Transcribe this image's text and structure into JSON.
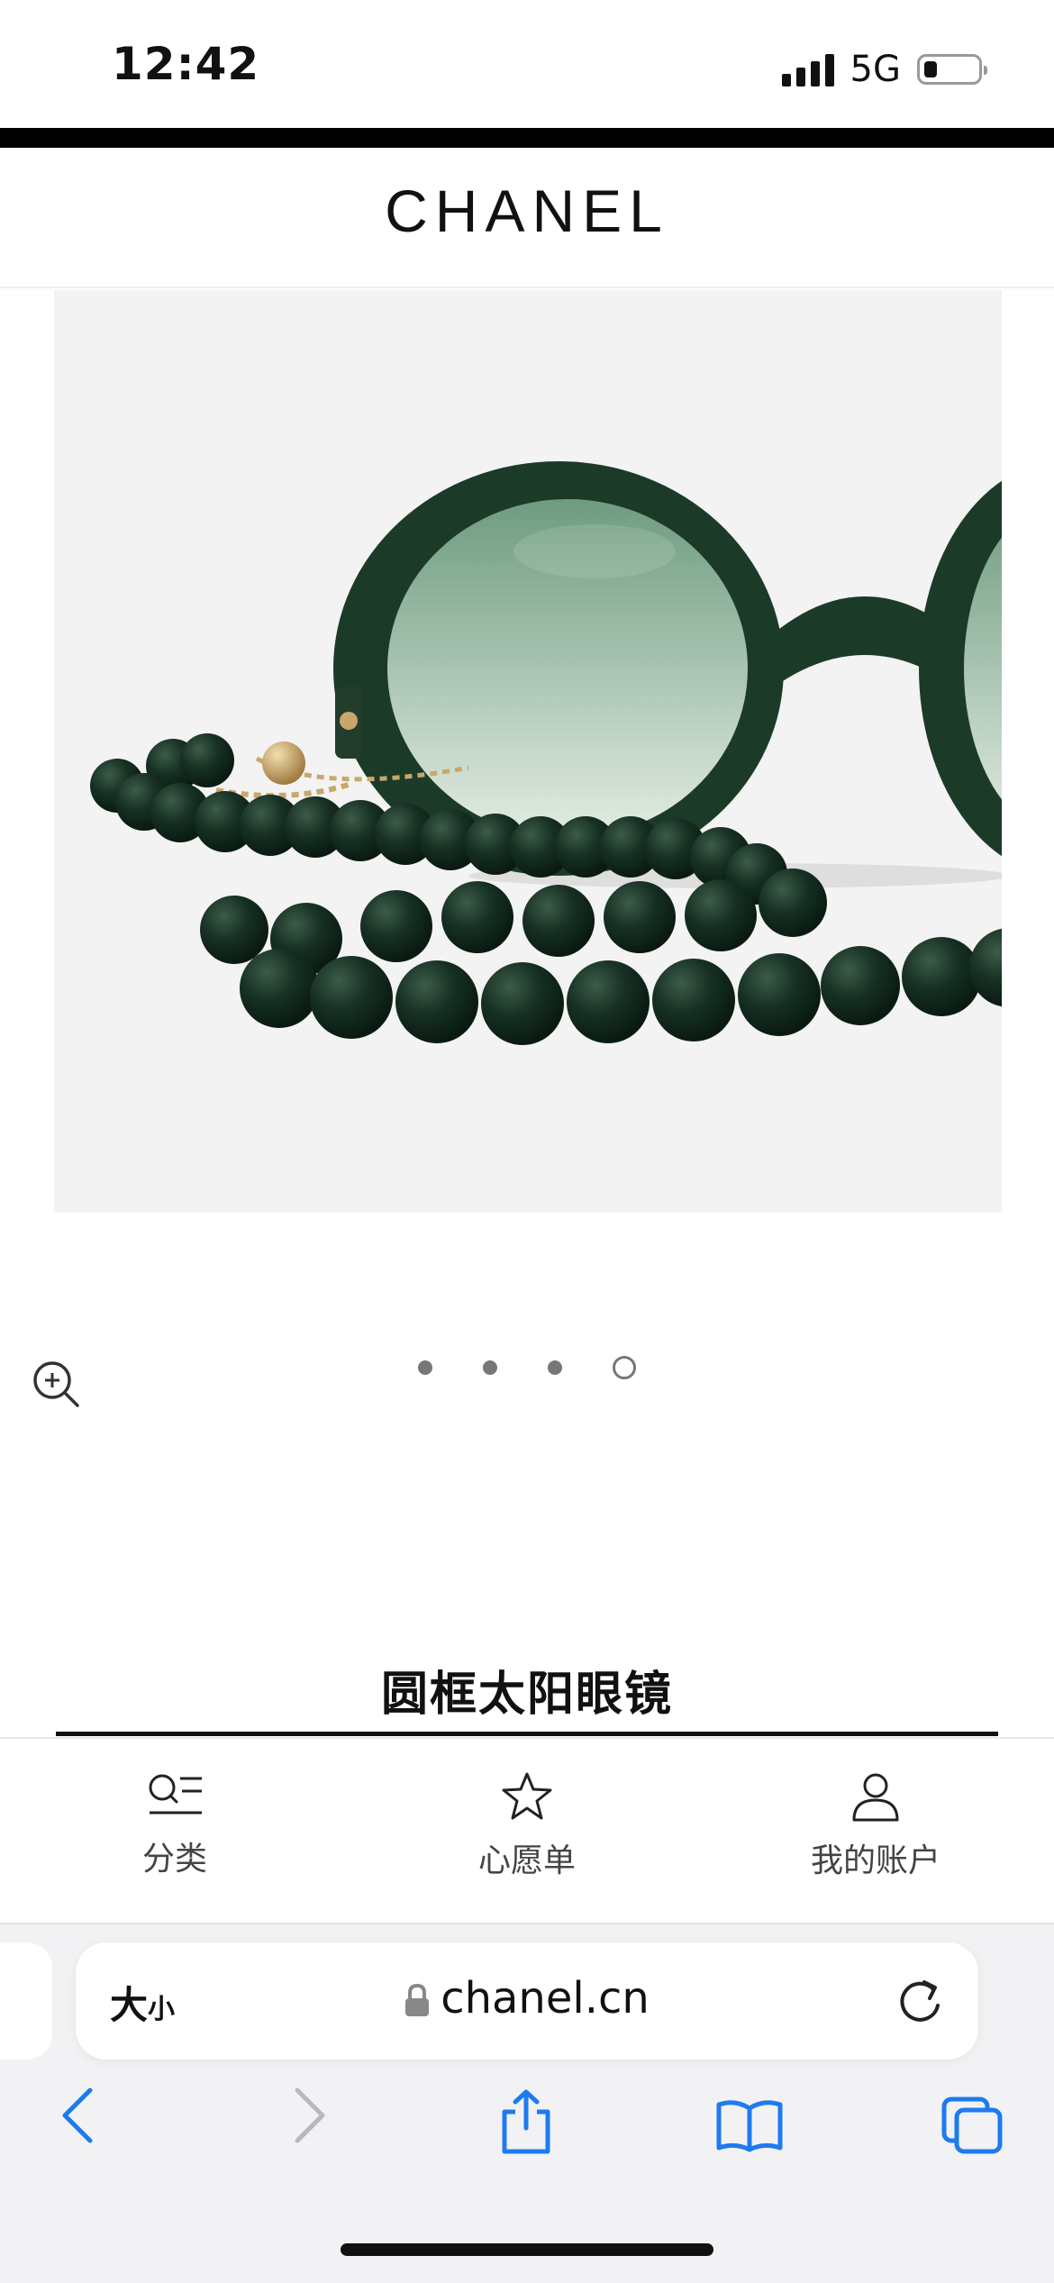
{
  "status_bar": {
    "time": "12:42",
    "network": "5G"
  },
  "header": {
    "brand": "CHANEL"
  },
  "carousel": {
    "slide_count": 4,
    "active_index": 3
  },
  "product": {
    "title": "圆框太阳眼镜"
  },
  "bottom_nav": [
    {
      "label": "分类",
      "icon": "category-icon"
    },
    {
      "label": "心愿单",
      "icon": "star-icon"
    },
    {
      "label": "我的账户",
      "icon": "person-icon"
    }
  ],
  "browser": {
    "text_size_label": "大",
    "text_size_small": "小",
    "url": "chanel.cn"
  },
  "colors": {
    "accent_blue": "#1d7bf0",
    "frame_green": "#1c3a28"
  }
}
